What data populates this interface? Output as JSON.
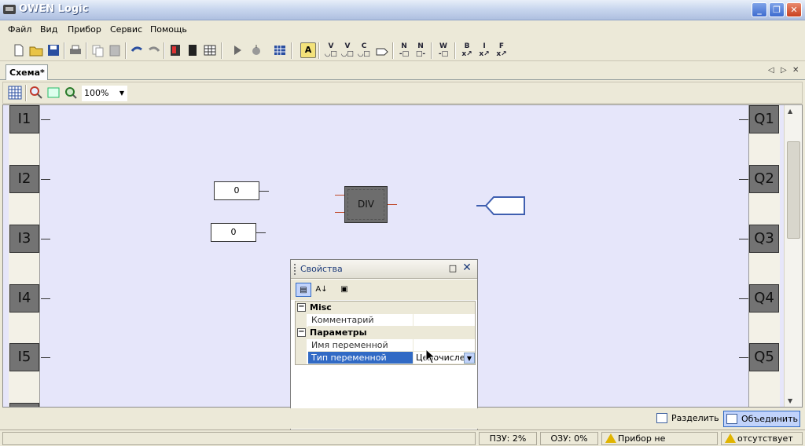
{
  "window": {
    "title": "OWEN Logic"
  },
  "menu": [
    "Файл",
    "Вид",
    "Прибор",
    "Сервис",
    "Помощь"
  ],
  "toolbar": {
    "letter_buttons": [
      "A",
      "V",
      "V",
      "C",
      "N",
      "N",
      "W",
      "B",
      "I",
      "F"
    ]
  },
  "tabs": [
    {
      "label": "Схема*"
    }
  ],
  "subtoolbar": {
    "zoom": "100%"
  },
  "canvas": {
    "inputs": [
      "I1",
      "I2",
      "I3",
      "I4",
      "I5"
    ],
    "outputs": [
      "Q1",
      "Q2",
      "Q3",
      "Q4",
      "Q5"
    ],
    "constants": [
      "0",
      "0"
    ],
    "block": {
      "label": "DIV"
    }
  },
  "properties": {
    "title": "Свойства",
    "categories": [
      {
        "name": "Misc",
        "rows": [
          {
            "name": "Комментарий",
            "value": ""
          }
        ]
      },
      {
        "name": "Параметры",
        "rows": [
          {
            "name": "Имя переменной",
            "value": ""
          },
          {
            "name": "Тип переменной",
            "value": "Целочисле",
            "selected": true
          }
        ]
      }
    ]
  },
  "split": {
    "split_label": "Разделить",
    "join_label": "Объединить"
  },
  "status": {
    "rom": "ПЗУ: 2%",
    "ram": "ОЗУ: 0%",
    "device": "Прибор не подключен",
    "absent": "отсутствует"
  }
}
